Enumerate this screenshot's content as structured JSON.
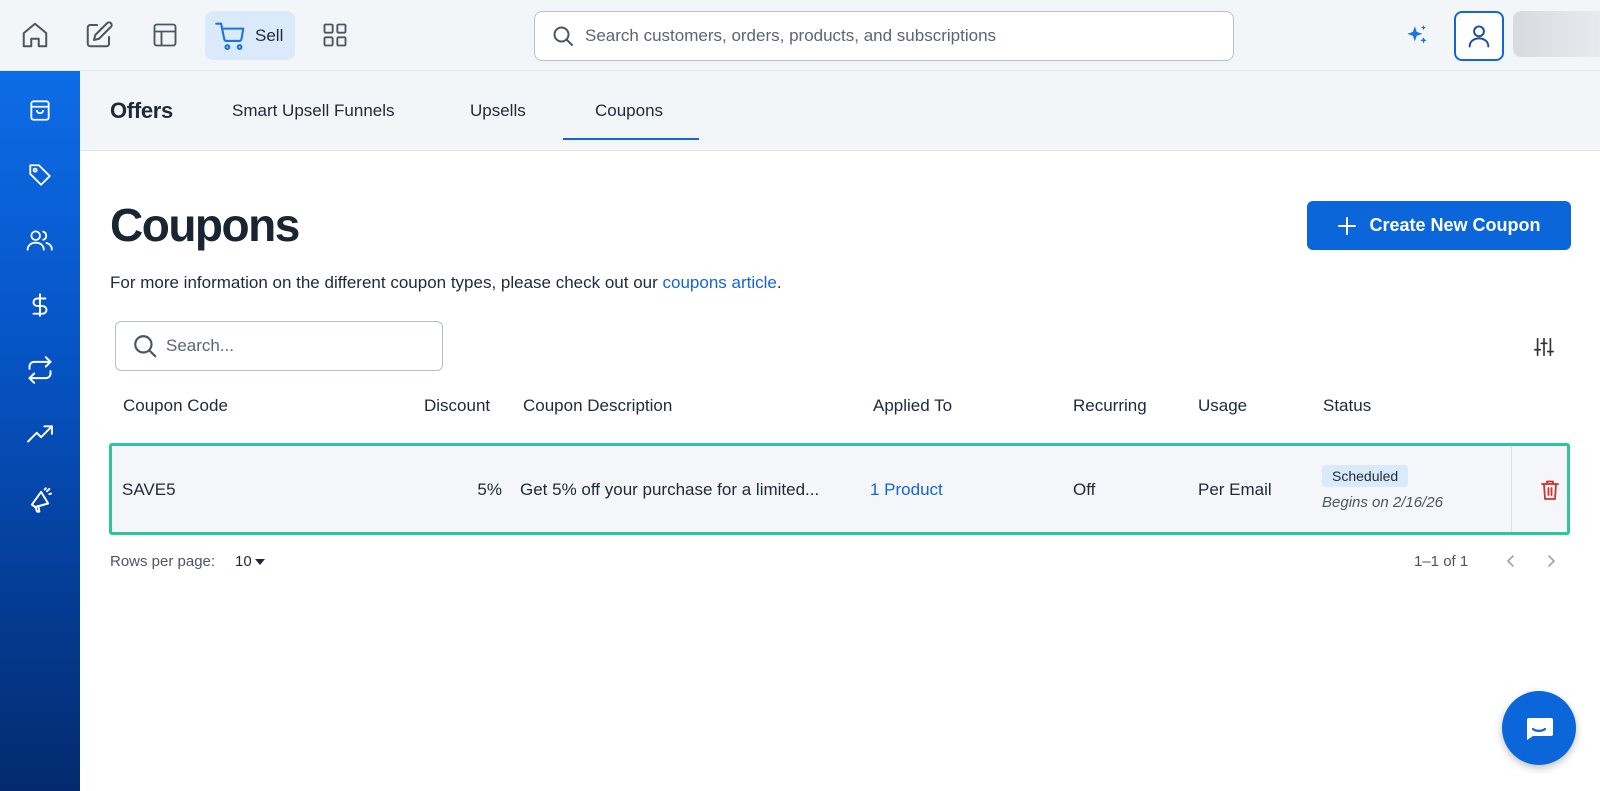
{
  "topbar": {
    "icons": [
      "home-icon",
      "edit-icon",
      "layout-icon",
      "cart-icon",
      "grid-icon"
    ],
    "sell_label": "Sell",
    "search_placeholder": "Search customers, orders, products, and subscriptions"
  },
  "sidebar": {
    "items": [
      "bag-icon",
      "tag-icon",
      "users-icon",
      "dollar-icon",
      "repeat-icon",
      "trending-icon",
      "megaphone-icon"
    ]
  },
  "subnav": {
    "title": "Offers",
    "tabs": [
      {
        "label": "Smart Upsell Funnels",
        "active": false
      },
      {
        "label": "Upsells",
        "active": false
      },
      {
        "label": "Coupons",
        "active": true
      }
    ]
  },
  "main": {
    "title": "Coupons",
    "create_button": "Create New Coupon",
    "info_text": "For more information on the different coupon types, please check out our ",
    "info_link": "coupons article",
    "info_end": ".",
    "search_placeholder": "Search..."
  },
  "table": {
    "headers": [
      "Coupon Code",
      "Discount",
      "Coupon Description",
      "Applied To",
      "Recurring",
      "Usage",
      "Status"
    ],
    "rows": [
      {
        "code": "SAVE5",
        "discount": "5%",
        "description": "Get 5% off your purchase for a limited...",
        "applied_to": "1 Product",
        "recurring": "Off",
        "usage": "Per Email",
        "status": "Scheduled",
        "status_sub": "Begins on 2/16/26"
      }
    ],
    "footer": {
      "rows_per_page_label": "Rows per page:",
      "rows_per_page": "10",
      "page_info": "1–1 of 1"
    }
  },
  "colors": {
    "primary": "#0b66d9",
    "row_highlight": "#2cc59e",
    "delete": "#d32f2f"
  }
}
